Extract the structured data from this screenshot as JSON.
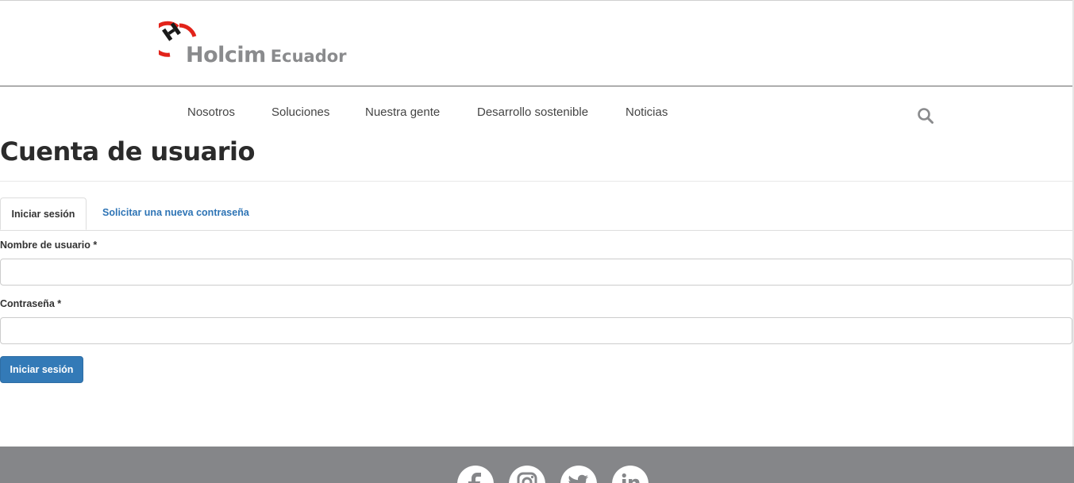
{
  "header": {
    "logo": {
      "brand": "Holcim",
      "country": "Ecuador",
      "accent_color": "#e2231a",
      "text_color": "#8a8b8d"
    }
  },
  "nav": {
    "items": [
      {
        "label": "Nosotros"
      },
      {
        "label": "Soluciones"
      },
      {
        "label": "Nuestra gente"
      },
      {
        "label": "Desarrollo sostenible"
      },
      {
        "label": "Noticias"
      }
    ],
    "search_icon": "search-icon"
  },
  "main": {
    "title": "Cuenta de usuario",
    "tabs": [
      {
        "label": "Iniciar sesión",
        "active": true
      },
      {
        "label": "Solicitar una nueva contraseña",
        "active": false
      }
    ],
    "form": {
      "username": {
        "label": "Nombre de usuario *",
        "value": ""
      },
      "password": {
        "label": "Contraseña *",
        "value": ""
      },
      "submit_label": "Iniciar sesión"
    }
  },
  "footer": {
    "background_color": "#858689",
    "social_icons": [
      "facebook-icon",
      "instagram-icon",
      "twitter-icon",
      "linkedin-icon"
    ]
  },
  "colors": {
    "link": "#2e74b5",
    "button": "#337ab7",
    "title": "#2b2b2b"
  }
}
